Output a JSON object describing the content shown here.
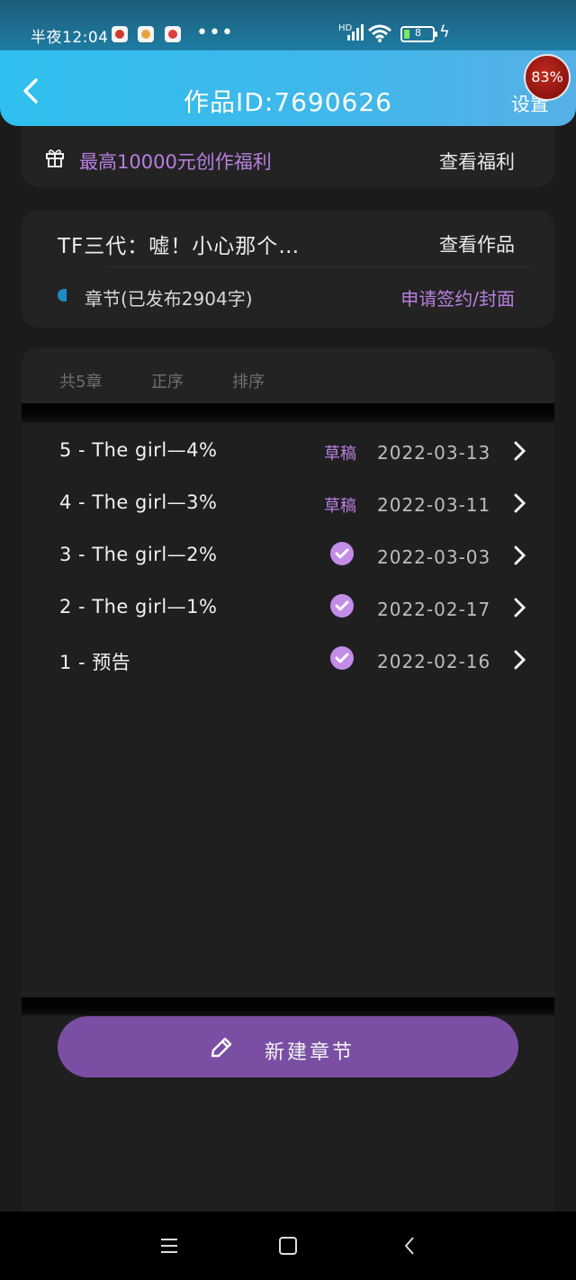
{
  "status_bar": {
    "time": "半夜12:04",
    "more": "•••",
    "network": "HD",
    "battery": "8",
    "colors": {
      "battery_fill": "#7ee85e"
    }
  },
  "header": {
    "back_icon": "chevron-left-icon",
    "title": "作品ID:7690626",
    "settings": "设置",
    "floating_badge": "83%"
  },
  "welfare": {
    "icon": "gift-icon",
    "text": "最高10000元创作福利",
    "link": "查看福利"
  },
  "work": {
    "name": "TF三代：嘘！小心那个…",
    "view_link": "查看作品",
    "chapters_status": "章节(已发布2904字)",
    "sign_link": "申请签约/封面"
  },
  "chapter_panel": {
    "count": "共5章",
    "order": "正序",
    "sort": "排序"
  },
  "chapters": [
    {
      "title": "5 - The girl—4%",
      "status": "草稿",
      "date": "2022-03-13",
      "published": false
    },
    {
      "title": "4 - The girl—3%",
      "status": "草稿",
      "date": "2022-03-11",
      "published": false
    },
    {
      "title": "3 - The girl—2%",
      "status": "published",
      "date": "2022-03-03",
      "published": true
    },
    {
      "title": "2 - The girl—1%",
      "status": "published",
      "date": "2022-02-17",
      "published": true
    },
    {
      "title": "1 - 预告",
      "status": "published",
      "date": "2022-02-16",
      "published": true
    }
  ],
  "new_chapter_button": {
    "icon": "pencil-icon",
    "label": "新建章节"
  },
  "theme": {
    "accent_purple": "#b97fe0",
    "button_purple": "#7a4fa3",
    "header_blue": "#2fc0ef",
    "badge_red": "#c12a1f"
  }
}
